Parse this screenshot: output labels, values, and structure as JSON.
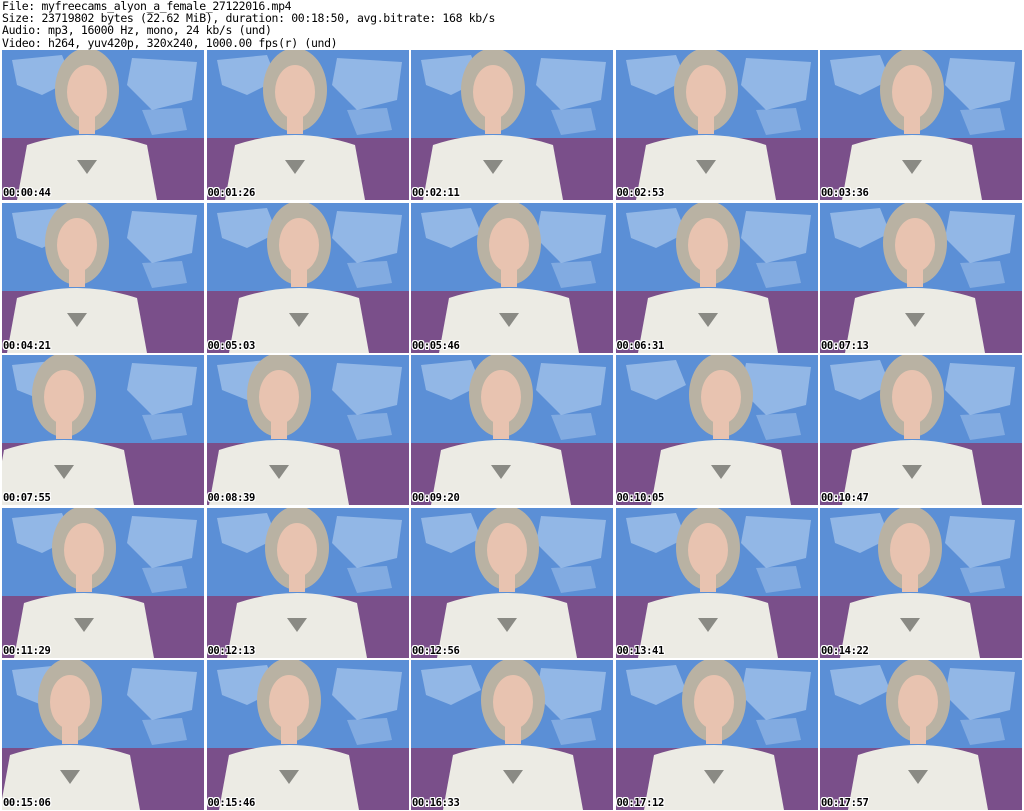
{
  "header": {
    "file_line": "File: myfreecams_alyon_a_female_27122016.mp4",
    "size_line": "Size: 23719802 bytes (22.62 MiB), duration: 00:18:50, avg.bitrate: 168 kb/s",
    "audio_line": "Audio: mp3, 16000 Hz, mono, 24 kb/s (und)",
    "video_line": "Video: h264, yuv420p, 320x240, 1000.00 fps(r) (und)"
  },
  "colors": {
    "wall_purple": "#7a4f8a",
    "map_blue": "#5b8fd6",
    "map_land": "#a9c7ec",
    "hair": "#b9b2a3",
    "skin": "#e8c3b0",
    "top_white": "#ecebe4",
    "timestamp_text": "#000000",
    "timestamp_outline": "#ffffff"
  },
  "thumbnails": [
    {
      "timestamp": "00:00:44"
    },
    {
      "timestamp": "00:01:26"
    },
    {
      "timestamp": "00:02:11"
    },
    {
      "timestamp": "00:02:53"
    },
    {
      "timestamp": "00:03:36"
    },
    {
      "timestamp": "00:04:21"
    },
    {
      "timestamp": "00:05:03"
    },
    {
      "timestamp": "00:05:46"
    },
    {
      "timestamp": "00:06:31"
    },
    {
      "timestamp": "00:07:13"
    },
    {
      "timestamp": "00:07:55"
    },
    {
      "timestamp": "00:08:39"
    },
    {
      "timestamp": "00:09:20"
    },
    {
      "timestamp": "00:10:05"
    },
    {
      "timestamp": "00:10:47"
    },
    {
      "timestamp": "00:11:29"
    },
    {
      "timestamp": "00:12:13"
    },
    {
      "timestamp": "00:12:56"
    },
    {
      "timestamp": "00:13:41"
    },
    {
      "timestamp": "00:14:22"
    },
    {
      "timestamp": "00:15:06"
    },
    {
      "timestamp": "00:15:46"
    },
    {
      "timestamp": "00:16:33"
    },
    {
      "timestamp": "00:17:12"
    },
    {
      "timestamp": "00:17:57"
    }
  ]
}
